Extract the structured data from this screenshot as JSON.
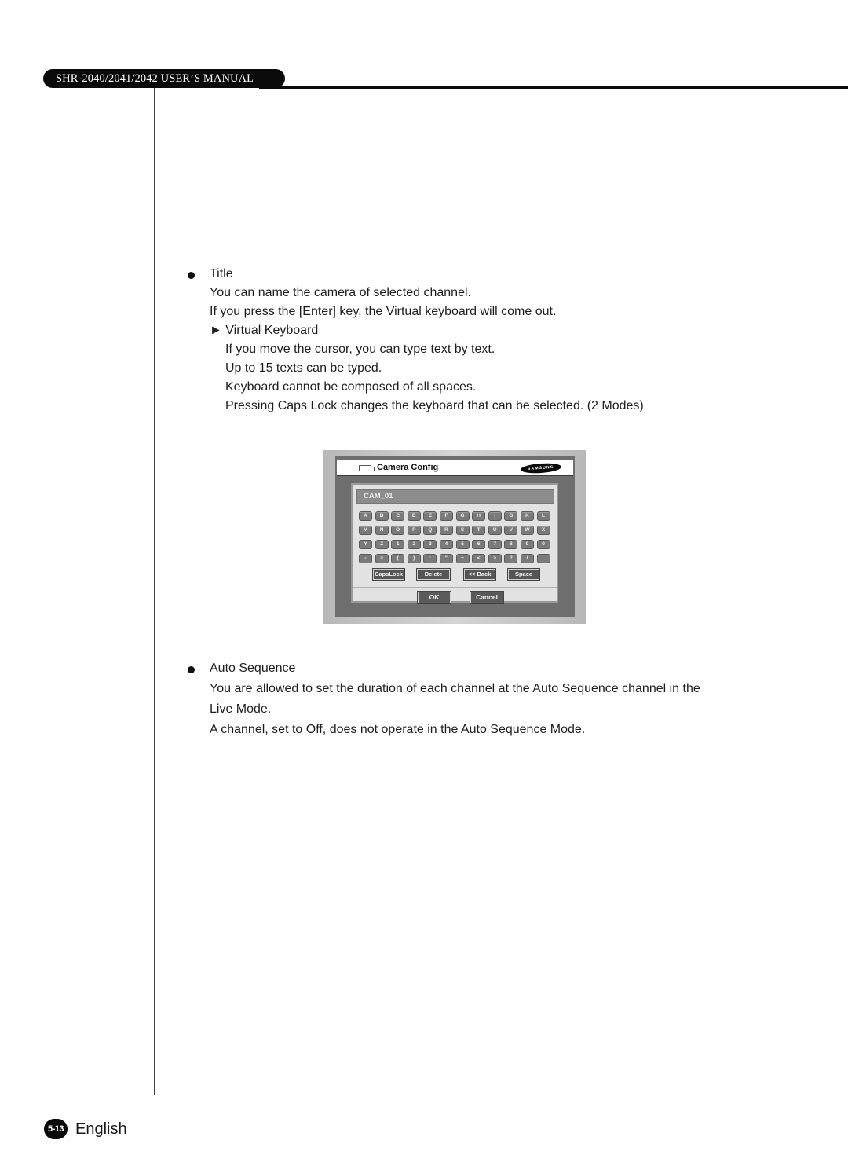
{
  "header": {
    "manual_title": "SHR-2040/2041/2042 USER’S MANUAL"
  },
  "sections": [
    {
      "heading": "Title",
      "lines": [
        "You can name the camera of selected channel.",
        "If you press the [Enter] key, the Virtual keyboard will come out."
      ],
      "subsection": {
        "marker": "►",
        "heading": "Virtual Keyboard",
        "lines": [
          "If you move the cursor, you can type text by text.",
          "Up to 15 texts can be typed.",
          "Keyboard cannot be composed of all spaces.",
          "Pressing Caps Lock changes the keyboard that can be selected. (2 Modes)"
        ]
      }
    },
    {
      "heading": "Auto Sequence",
      "lines": [
        "You are allowed to set the duration of each channel at the Auto Sequence channel in the",
        "Live Mode.",
        "A channel, set to Off, does not operate in the Auto Sequence Mode."
      ]
    }
  ],
  "screenshot": {
    "window_title": "Camera Config",
    "brand_logo": "SAMSUNG",
    "title_icon": "camera-icon",
    "input_value": "CAM_01",
    "keys": [
      [
        "A",
        "B",
        "C",
        "D",
        "E",
        "F",
        "G",
        "H",
        "I",
        "G",
        "K",
        "L"
      ],
      [
        "M",
        "N",
        "O",
        "P",
        "Q",
        "R",
        "S",
        "T",
        "U",
        "V",
        "W",
        "X"
      ],
      [
        "Y",
        "Z",
        "1",
        "2",
        "3",
        "4",
        "5",
        "6",
        "7",
        "8",
        "9",
        "0"
      ],
      [
        "-",
        "=",
        "{",
        "}",
        ":",
        "\"",
        "~",
        "<",
        ">",
        "?",
        "/",
        ""
      ]
    ],
    "function_buttons": {
      "capslock": "CapsLock",
      "delete": "Delete",
      "back": "<< Back",
      "space": "Space"
    },
    "ok": "OK",
    "cancel": "Cancel"
  },
  "footer": {
    "page_number": "5-13",
    "language": "English"
  }
}
